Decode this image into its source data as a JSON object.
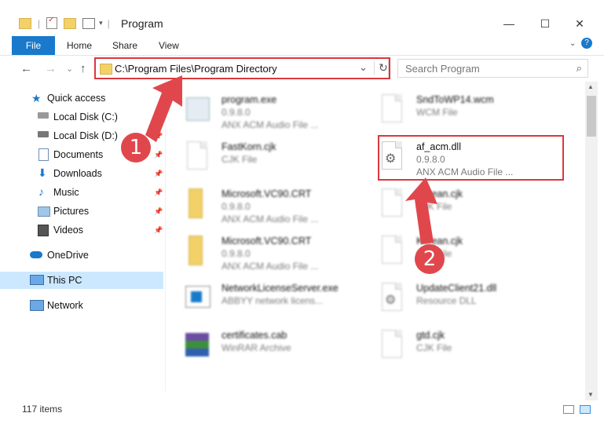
{
  "window": {
    "title": "Program",
    "controls": {
      "minimize": "—",
      "maximize": "☐",
      "close": "✕"
    }
  },
  "ribbon": {
    "tabs": [
      "File",
      "Home",
      "Share",
      "View"
    ],
    "help": "?"
  },
  "nav": {
    "back": "←",
    "forward": "→",
    "recent": "⌄",
    "up": "↑"
  },
  "address": {
    "path": "C:\\Program Files\\Program Directory",
    "dropdown": "⌄",
    "refresh": "↻"
  },
  "search": {
    "placeholder": "Search Program",
    "icon": "⌕"
  },
  "navpane": {
    "quick_access": "Quick access",
    "items": [
      {
        "label": "Local Disk (C:)",
        "icon": "drive-icon",
        "pinned": true
      },
      {
        "label": "Local Disk (D:)",
        "icon": "drive-icon",
        "pinned": true
      },
      {
        "label": "Documents",
        "icon": "documents-icon",
        "pinned": true
      },
      {
        "label": "Downloads",
        "icon": "downloads-icon",
        "pinned": true
      },
      {
        "label": "Music",
        "icon": "music-icon",
        "pinned": true
      },
      {
        "label": "Pictures",
        "icon": "pictures-icon",
        "pinned": true
      },
      {
        "label": "Videos",
        "icon": "videos-icon",
        "pinned": true
      }
    ],
    "onedrive": "OneDrive",
    "this_pc": "This PC",
    "network": "Network"
  },
  "files": [
    {
      "name": "program.exe",
      "line2": "0.9.8.0",
      "line3": "ANX ACM Audio File ...",
      "icon": "exe-icon"
    },
    {
      "name": "SndToWP14.wcm",
      "line2": "WCM File",
      "line3": "",
      "icon": "document-icon"
    },
    {
      "name": "FastKorn.cjk",
      "line2": "CJK File",
      "line3": "",
      "icon": "document-icon"
    },
    {
      "name": "af_acm.dll",
      "line2": "0.9.8.0",
      "line3": "ANX ACM Audio File ...",
      "icon": "dll-gear-icon"
    },
    {
      "name": "Microsoft.VC90.CRT",
      "line2": "0.9.8.0",
      "line3": "ANX ACM Audio File ...",
      "icon": "folder-icon"
    },
    {
      "name": "Korean.cjk",
      "line2": "CJK File",
      "line3": "",
      "icon": "document-icon"
    },
    {
      "name": "Microsoft.VC90.CRT",
      "line2": "0.9.8.0",
      "line3": "ANX ACM Audio File ...",
      "icon": "folder-icon"
    },
    {
      "name": "Korean.cjk",
      "line2": "CJK File",
      "line3": "",
      "icon": "document-icon"
    },
    {
      "name": "NetworkLicenseServer.exe",
      "line2": "ABBYY network licens...",
      "line3": "",
      "icon": "exe-icon"
    },
    {
      "name": "UpdateClient21.dll",
      "line2": "Resource DLL",
      "line3": "",
      "icon": "dll-gear-icon"
    },
    {
      "name": "certificates.cab",
      "line2": "WinRAR Archive",
      "line3": "",
      "icon": "archive-icon"
    },
    {
      "name": "gtd.cjk",
      "line2": "CJK File",
      "line3": "",
      "icon": "document-icon"
    }
  ],
  "annotations": {
    "step1": "1",
    "step2": "2"
  },
  "status": {
    "item_count": "117 items"
  },
  "colors": {
    "accent": "#1979ca",
    "highlight": "#d9383f",
    "badge": "#e0474c",
    "selected": "#cce8ff"
  }
}
